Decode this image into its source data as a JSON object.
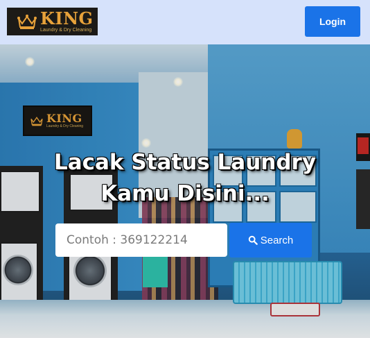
{
  "navbar": {
    "brand_name": "KING",
    "brand_tagline": "Laundry & Dry Cleaning",
    "login_label": "Login",
    "login_color": "#1a73e8",
    "background_color": "#d6e2fb"
  },
  "hero": {
    "headline": "Lacak Status Laundry Kamu Disini...",
    "wall_sign_name": "KING",
    "wall_sign_tagline": "Laundry & Dry Cleaning"
  },
  "search": {
    "placeholder": "Contoh : 369122214",
    "button_label": "Search",
    "button_icon": "search-icon",
    "button_color": "#1a73e8"
  }
}
